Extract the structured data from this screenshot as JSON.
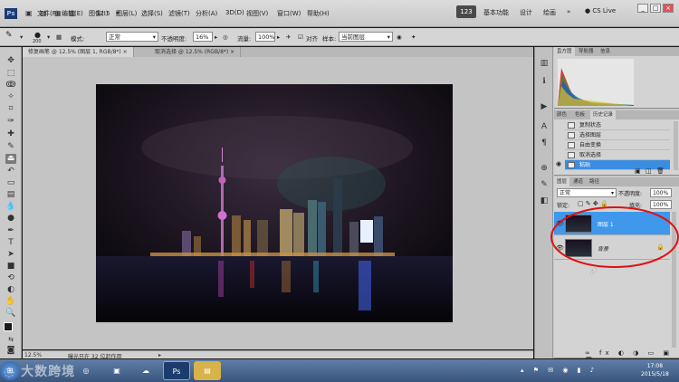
{
  "menubar": {
    "app_logo": "Ps",
    "zoom": "12.5",
    "menus": [
      "文件(F)",
      "编辑(E)",
      "图像(I)",
      "图层(L)",
      "选择(S)",
      "滤镜(T)",
      "分析(A)",
      "3D(D)",
      "视图(V)",
      "窗口(W)",
      "帮助(H)"
    ],
    "workspace_badge": "123",
    "workspaces": [
      "基本功能",
      "设计",
      "绘画"
    ],
    "cs_live": "CS Live"
  },
  "options": {
    "brush_size": "200",
    "mode_label": "模式:",
    "mode_value": "正常",
    "opacity_label": "不透明度:",
    "opacity_value": "16%",
    "flow_label": "流量:",
    "flow_value": "100%",
    "align_label": "对齐",
    "sample_label": "样本:",
    "sample_value": "当前图层"
  },
  "tabs": [
    {
      "label": "修复画笔 @ 12.5% (图层 1, RGB/8*) ×",
      "active": true
    },
    {
      "label": "取消选择 @ 12.5% (RGB/8*) ×",
      "active": false
    }
  ],
  "status": {
    "zoom": "12.5%",
    "info": "曝光只在 32 位起作用"
  },
  "panels": {
    "histogram_tabs": [
      "直方图",
      "导航器",
      "信息"
    ],
    "history_tabs": [
      "颜色",
      "色板",
      "历史记录"
    ],
    "history_items": [
      "复制状态",
      "选择图层",
      "自由变换",
      "取消选择",
      "粘贴"
    ],
    "layers_tabs": [
      "图层",
      "通道",
      "路径"
    ],
    "blend_mode": "正常",
    "opacity_label": "不透明度:",
    "opacity_value": "100%",
    "lock_label": "锁定:",
    "fill_label": "填充:",
    "fill_value": "100%",
    "layers": [
      {
        "name": "图层 1",
        "active": true
      },
      {
        "name": "背景",
        "active": false
      }
    ]
  },
  "taskbar": {
    "time": "17:08",
    "date": "2015/5/18",
    "watermark": "大数跨境"
  },
  "colors": {
    "highlight": "#3b8de0",
    "annotation_circle": "#e01010",
    "background_swatch": "#a8b28c"
  },
  "icons": [
    "move-icon",
    "marquee-icon",
    "lasso-icon",
    "quick-select-icon",
    "crop-icon",
    "eyedropper-icon",
    "healing-brush-icon",
    "brush-icon",
    "clone-stamp-icon",
    "history-brush-icon",
    "eraser-icon",
    "gradient-icon",
    "blur-icon",
    "dodge-icon",
    "pen-icon",
    "type-icon",
    "path-select-icon",
    "shape-icon",
    "hand-icon",
    "zoom-icon"
  ]
}
